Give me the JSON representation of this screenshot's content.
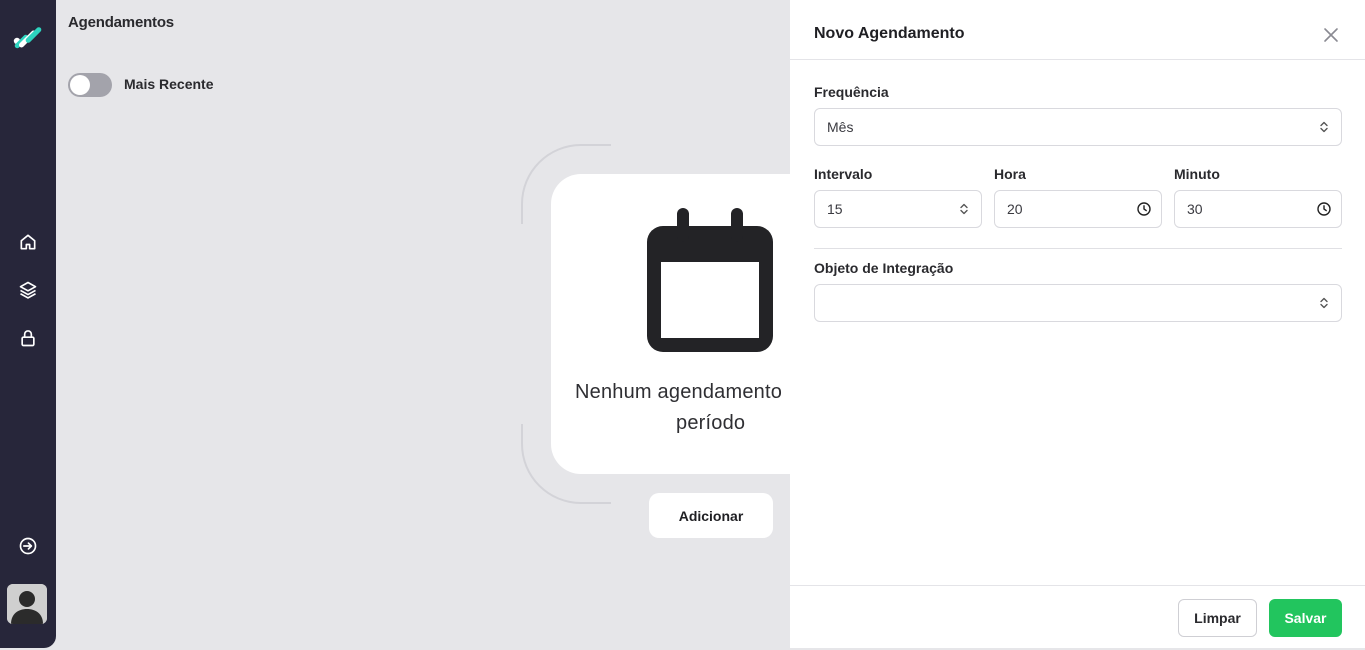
{
  "page": {
    "title": "Agendamentos"
  },
  "sidebar": {
    "items": [
      {
        "icon": "home-icon"
      },
      {
        "icon": "layers-icon"
      },
      {
        "icon": "lock-icon"
      },
      {
        "icon": "logout-icon"
      }
    ]
  },
  "filters": {
    "toggle_label": "Mais Recente",
    "toggle_on": false
  },
  "empty_state": {
    "line1": "Nenhum agendamento",
    "line2": "período",
    "icon": "calendar-icon",
    "add_label": "Adicionar"
  },
  "drawer": {
    "title": "Novo Agendamento",
    "frequency": {
      "label": "Frequência",
      "value": "Mês"
    },
    "interval": {
      "label": "Intervalo",
      "value": "15"
    },
    "hour": {
      "label": "Hora",
      "value": "20"
    },
    "minute": {
      "label": "Minuto",
      "value": "30"
    },
    "integration_object": {
      "label": "Objeto de Integração",
      "value": ""
    },
    "clear_label": "Limpar",
    "save_label": "Salvar"
  },
  "colors": {
    "sidebar_bg": "#27263a",
    "accent": "#22c55e",
    "logo_accent": "#2dd4bf"
  }
}
